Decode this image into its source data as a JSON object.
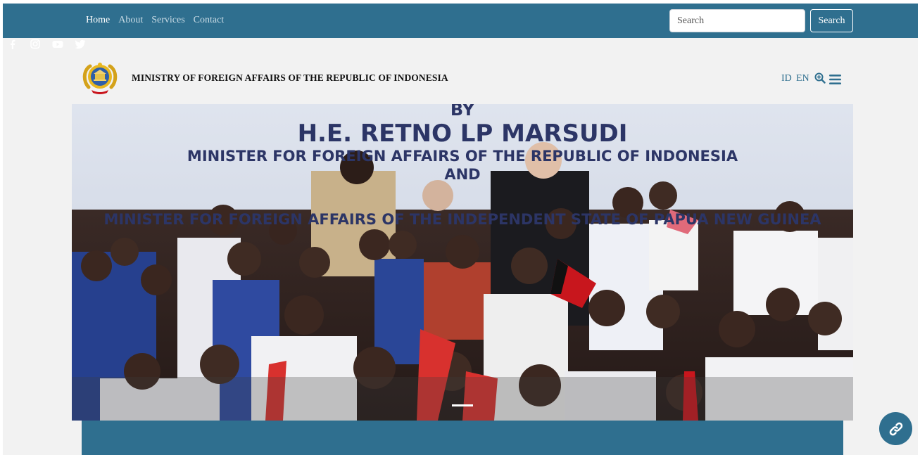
{
  "nav": {
    "links": [
      "Home",
      "About",
      "Services",
      "Contact"
    ],
    "active": "Home"
  },
  "search": {
    "placeholder": "Search",
    "button_label": "Search"
  },
  "social_icons": [
    "facebook-icon",
    "instagram-icon",
    "youtube-icon",
    "twitter-icon"
  ],
  "header": {
    "title": "MINISTRY OF FOREIGN AFFAIRS OF THE REPUBLIC OF INDONESIA",
    "lang_id": "ID",
    "lang_en": "EN"
  },
  "hero": {
    "banner_lines": [
      "BY",
      "H.E. RETNO LP MARSUDI",
      "MINISTER FOR FOREIGN AFFAIRS OF THE REPUBLIC OF INDONESIA",
      "AND",
      "MINISTER FOR FOREIGN AFFAIRS OF THE INDEPENDENT STATE OF PAPUA NEW GUINEA"
    ],
    "image_description_icon": "photo-icon"
  },
  "colors": {
    "primary": "#2f6f8f",
    "background": "#f2f2f2"
  }
}
